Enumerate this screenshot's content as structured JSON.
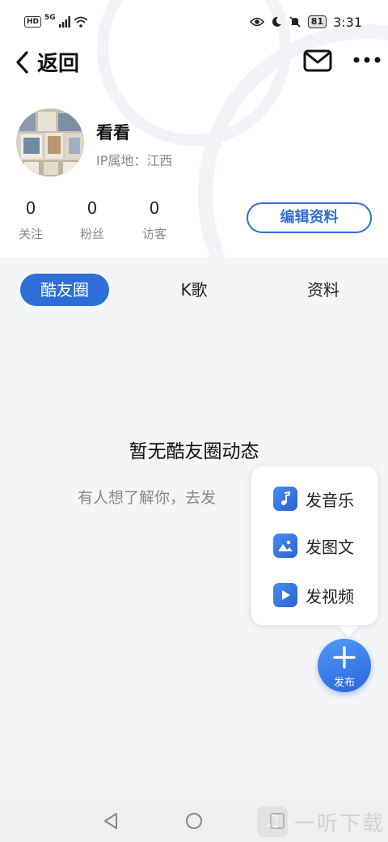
{
  "status_bar": {
    "hd": "HD",
    "network": "5G",
    "battery": "81",
    "time": "3:31"
  },
  "nav": {
    "back_label": "返回"
  },
  "profile": {
    "name": "看看",
    "ip_location": "IP属地：江西"
  },
  "stats": [
    {
      "value": "0",
      "label": "关注"
    },
    {
      "value": "0",
      "label": "粉丝"
    },
    {
      "value": "0",
      "label": "访客"
    }
  ],
  "edit_button": "编辑资料",
  "tabs": [
    {
      "label": "酷友圈",
      "active": true
    },
    {
      "label": "K歌",
      "active": false
    },
    {
      "label": "资料",
      "active": false
    }
  ],
  "empty_state": {
    "title": "暂无酷友圈动态",
    "subtitle": "有人想了解你，去发"
  },
  "publish_menu": {
    "items": [
      {
        "label": "发音乐",
        "icon": "music-note-icon"
      },
      {
        "label": "发图文",
        "icon": "image-icon"
      },
      {
        "label": "发视频",
        "icon": "play-icon"
      }
    ]
  },
  "fab": {
    "label": "发布"
  },
  "watermark": {
    "text": "一听下载"
  },
  "colors": {
    "accent": "#2d6ed8",
    "background": "#f4f5f7"
  }
}
